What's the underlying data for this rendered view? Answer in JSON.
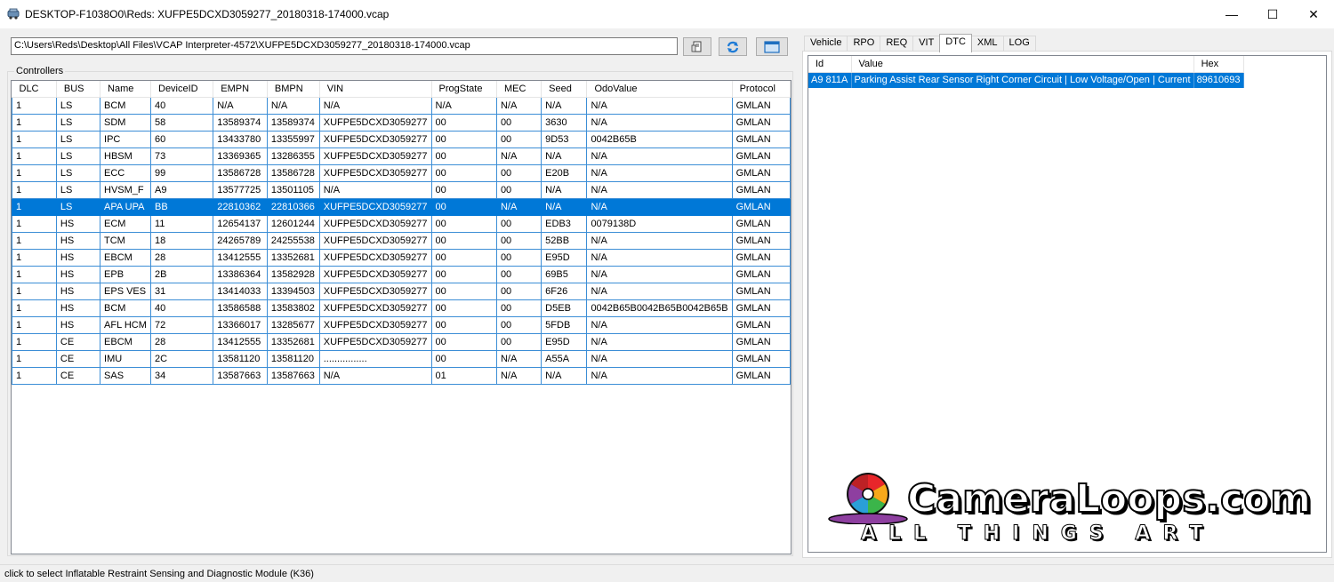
{
  "window": {
    "title": "DESKTOP-F1038O0\\Reds: XUFPE5DCXD3059277_20180318-174000.vcap",
    "controls": {
      "minimize": "—",
      "maximize": "☐",
      "close": "✕"
    }
  },
  "toolbar": {
    "path_value": "C:\\Users\\Reds\\Desktop\\All Files\\VCAP Interpreter-4572\\XUFPE5DCXD3059277_20180318-174000.vcap",
    "buttons": [
      "open-file-icon",
      "refresh-icon",
      "window-icon"
    ]
  },
  "controllers": {
    "label": "Controllers",
    "columns": [
      "DLC",
      "BUS",
      "Name",
      "DeviceID",
      "EMPN",
      "BMPN",
      "VIN",
      "ProgState",
      "MEC",
      "Seed",
      "OdoValue",
      "Protocol"
    ],
    "selected_row": 6,
    "rows": [
      [
        "1",
        "LS",
        "BCM",
        "40",
        "N/A",
        "N/A",
        "N/A",
        "N/A",
        "N/A",
        "N/A",
        "N/A",
        "GMLAN"
      ],
      [
        "1",
        "LS",
        "SDM",
        "58",
        "13589374",
        "13589374",
        "XUFPE5DCXD3059277",
        "00",
        "00",
        "3630",
        "N/A",
        "GMLAN"
      ],
      [
        "1",
        "LS",
        "IPC",
        "60",
        "13433780",
        "13355997",
        "XUFPE5DCXD3059277",
        "00",
        "00",
        "9D53",
        "0042B65B",
        "GMLAN"
      ],
      [
        "1",
        "LS",
        "HBSM",
        "73",
        "13369365",
        "13286355",
        "XUFPE5DCXD3059277",
        "00",
        "N/A",
        "N/A",
        "N/A",
        "GMLAN"
      ],
      [
        "1",
        "LS",
        "ECC",
        "99",
        "13586728",
        "13586728",
        "XUFPE5DCXD3059277",
        "00",
        "00",
        "E20B",
        "N/A",
        "GMLAN"
      ],
      [
        "1",
        "LS",
        "HVSM_F",
        "A9",
        "13577725",
        "13501105",
        "N/A",
        "00",
        "00",
        "N/A",
        "N/A",
        "GMLAN"
      ],
      [
        "1",
        "LS",
        "APA UPA",
        "BB",
        "22810362",
        "22810366",
        "XUFPE5DCXD3059277",
        "00",
        "N/A",
        "N/A",
        "N/A",
        "GMLAN"
      ],
      [
        "1",
        "HS",
        "ECM",
        "11",
        "12654137",
        "12601244",
        "XUFPE5DCXD3059277",
        "00",
        "00",
        "EDB3",
        "0079138D",
        "GMLAN"
      ],
      [
        "1",
        "HS",
        "TCM",
        "18",
        "24265789",
        "24255538",
        "XUFPE5DCXD3059277",
        "00",
        "00",
        "52BB",
        "N/A",
        "GMLAN"
      ],
      [
        "1",
        "HS",
        "EBCM",
        "28",
        "13412555",
        "13352681",
        "XUFPE5DCXD3059277",
        "00",
        "00",
        "E95D",
        "N/A",
        "GMLAN"
      ],
      [
        "1",
        "HS",
        "EPB",
        "2B",
        "13386364",
        "13582928",
        "XUFPE5DCXD3059277",
        "00",
        "00",
        "69B5",
        "N/A",
        "GMLAN"
      ],
      [
        "1",
        "HS",
        "EPS VES",
        "31",
        "13414033",
        "13394503",
        "XUFPE5DCXD3059277",
        "00",
        "00",
        "6F26",
        "N/A",
        "GMLAN"
      ],
      [
        "1",
        "HS",
        "BCM",
        "40",
        "13586588",
        "13583802",
        "XUFPE5DCXD3059277",
        "00",
        "00",
        "D5EB",
        "0042B65B0042B65B0042B65B",
        "GMLAN"
      ],
      [
        "1",
        "HS",
        "AFL HCM",
        "72",
        "13366017",
        "13285677",
        "XUFPE5DCXD3059277",
        "00",
        "00",
        "5FDB",
        "N/A",
        "GMLAN"
      ],
      [
        "1",
        "CE",
        "EBCM",
        "28",
        "13412555",
        "13352681",
        "XUFPE5DCXD3059277",
        "00",
        "00",
        "E95D",
        "N/A",
        "GMLAN"
      ],
      [
        "1",
        "CE",
        "IMU",
        "2C",
        "13581120",
        "13581120",
        "................",
        "00",
        "N/A",
        "A55A",
        "N/A",
        "GMLAN"
      ],
      [
        "1",
        "CE",
        "SAS",
        "34",
        "13587663",
        "13587663",
        "N/A",
        "01",
        "N/A",
        "N/A",
        "N/A",
        "GMLAN"
      ]
    ]
  },
  "tabs": {
    "items": [
      "Vehicle",
      "RPO",
      "REQ",
      "VIT",
      "DTC",
      "XML",
      "LOG"
    ],
    "active": "DTC"
  },
  "dtc": {
    "columns": [
      "Id",
      "Value",
      "Hex"
    ],
    "rows": [
      [
        "A9 811A",
        "Parking Assist Rear Sensor Right Corner Circuit | Low Voltage/Open | Current",
        "89610693"
      ]
    ]
  },
  "watermark": {
    "text": "CameraLoops.com",
    "subtext": "ALL THINGS ART",
    "colors": [
      "#e8262a",
      "#f7a81b",
      "#3bb54a",
      "#2a9fd8",
      "#8e3fa0"
    ]
  },
  "status": {
    "text": "click to select Inflatable Restraint Sensing and Diagnostic Module (K36)"
  },
  "colors": {
    "selection": "#0078d7",
    "grid_border": "#3c8ed6"
  }
}
